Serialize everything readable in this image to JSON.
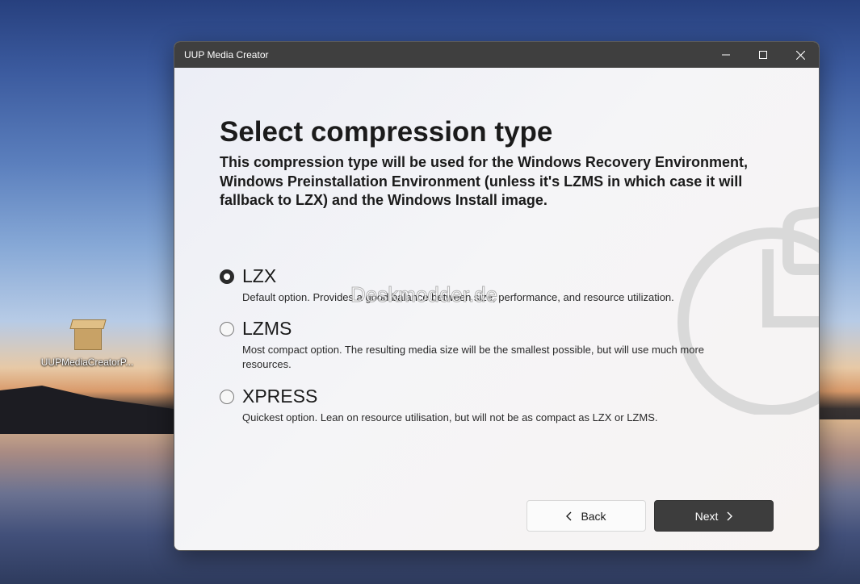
{
  "desktop": {
    "icon_label": "UUPMediaCreatorP..."
  },
  "window": {
    "title": "UUP Media Creator",
    "controls": {
      "minimize": "minimize-icon",
      "maximize": "maximize-icon",
      "close": "close-icon"
    }
  },
  "page": {
    "heading": "Select compression type",
    "subtitle": "This compression type will be used for the Windows Recovery Environment, Windows Preinstallation Environment (unless it's LZMS in which case it will fallback to LZX) and the Windows Install image.",
    "watermark": "Deskmodder.de"
  },
  "options": [
    {
      "name": "LZX",
      "description": "Default option. Provides a good balance between size, performance, and resource utilization.",
      "selected": true
    },
    {
      "name": "LZMS",
      "description": "Most compact option. The resulting media size will be the smallest possible, but will use much more resources.",
      "selected": false
    },
    {
      "name": "XPRESS",
      "description": "Quickest option. Lean on resource utilisation, but will not be as compact as LZX or LZMS.",
      "selected": false
    }
  ],
  "buttons": {
    "back_label": "Back",
    "next_label": "Next"
  },
  "colors": {
    "titlebar": "#3f3f3f",
    "primary_button": "#3d3d3d",
    "radio_checked": "#2b2b2b"
  }
}
